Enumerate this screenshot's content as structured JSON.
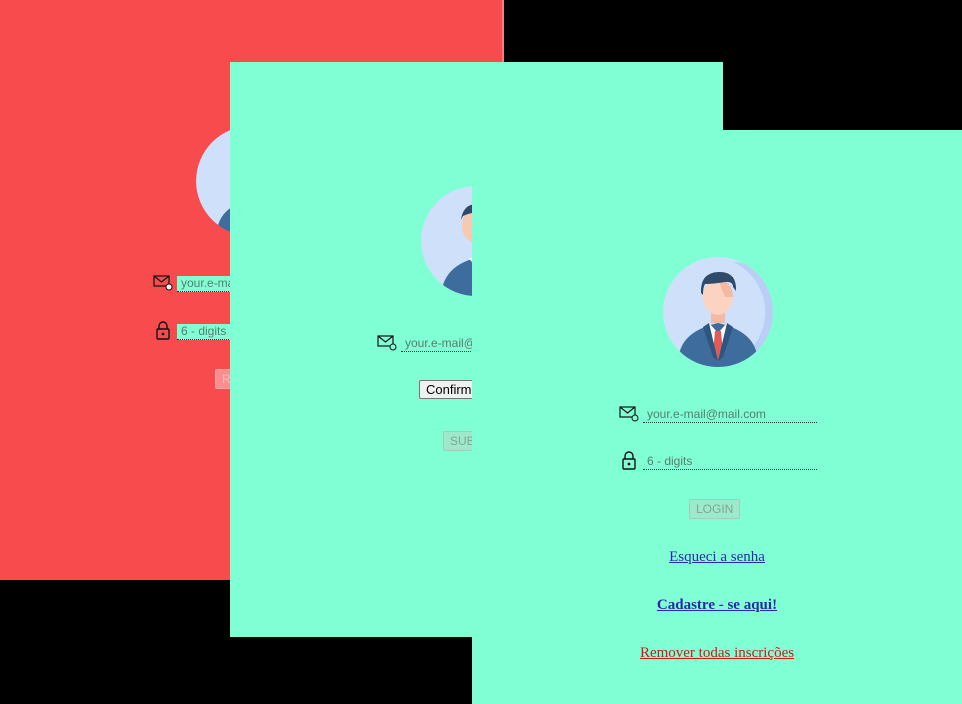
{
  "back_panel": {
    "email_placeholder": "your.e-mail@mail.com",
    "password_placeholder": "6 - digits",
    "button_label": "REGISTER"
  },
  "middle_panel": {
    "email_placeholder": "your.e-mail@mail.com",
    "confirm_label": "Confirmar",
    "submit_label": "SUBMIT"
  },
  "front_panel": {
    "email_placeholder": "your.e-mail@mail.com",
    "password_placeholder": "6 - digits",
    "login_label": "LOGIN",
    "forgot_link": "Esqueci a senha",
    "register_link": "Cadastre - se aqui!",
    "remove_link": "Remover todas inscrições"
  },
  "colors": {
    "red_panel": "#f84b4d",
    "mint_panel": "#80ffd4",
    "link_blue": "#2a2aa8",
    "link_red": "#cc1a1a"
  },
  "icons": [
    "avatar-icon",
    "mail-icon",
    "lock-icon"
  ]
}
